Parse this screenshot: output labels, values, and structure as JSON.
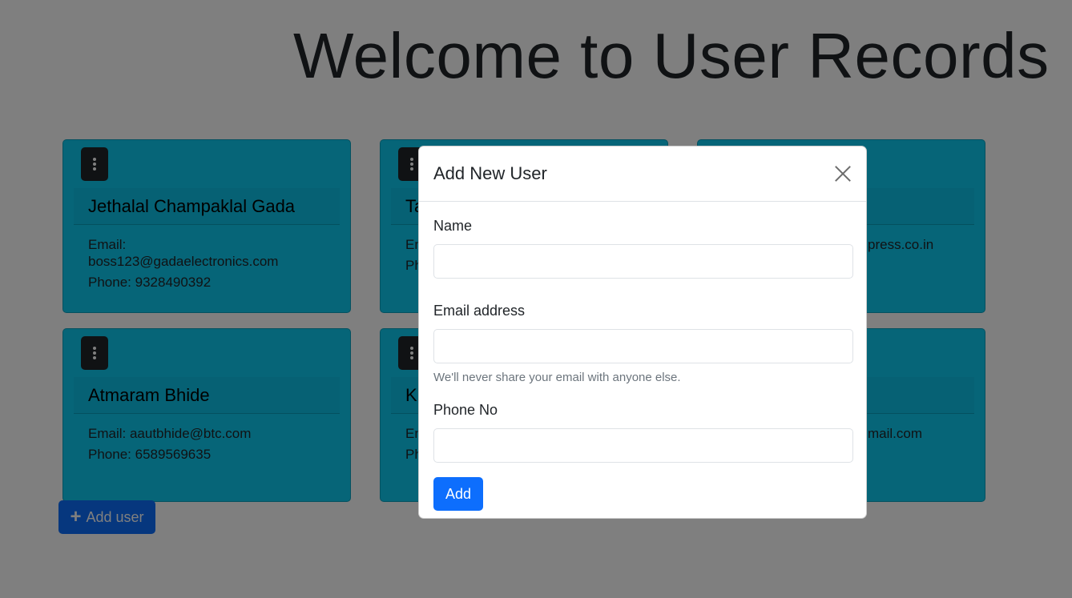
{
  "page": {
    "title": "Welcome to User Records"
  },
  "users": [
    {
      "name": "Jethalal Champaklal Gada",
      "email_label": "Email:",
      "email": "boss123@gadaelectronics.com",
      "phone_label": "Phone:",
      "phone": "9328490392"
    },
    {
      "name": "Ta",
      "email_label": "Em",
      "email": "",
      "phone_label": "Ph",
      "phone": ""
    },
    {
      "name": "",
      "email_label": "",
      "email": "press.co.in",
      "phone_label": "",
      "phone": ""
    },
    {
      "name": "Atmaram Bhide",
      "email_label": "Email:",
      "email": "aautbhide@btc.com",
      "phone_label": "Phone:",
      "phone": "6589569635"
    },
    {
      "name": "Ki",
      "email_label": "Em",
      "email": "",
      "phone_label": "Ph",
      "phone": ""
    },
    {
      "name": "",
      "email_label": "",
      "email": "mail.com",
      "phone_label": "",
      "phone": ""
    }
  ],
  "actions": {
    "add_user_label": "Add user",
    "add_user_icon": "plus-icon"
  },
  "modal": {
    "title": "Add New User",
    "close_icon": "close-icon",
    "name_label": "Name",
    "name_value": "",
    "email_label": "Email address",
    "email_value": "",
    "email_help": "We'll never share your email with anyone else.",
    "phone_label": "Phone No",
    "phone_value": "",
    "submit_label": "Add"
  },
  "colors": {
    "card_background": "#0dcaf0",
    "primary_button": "#0d6efd",
    "backdrop": "rgba(0,0,0,0.5)"
  }
}
